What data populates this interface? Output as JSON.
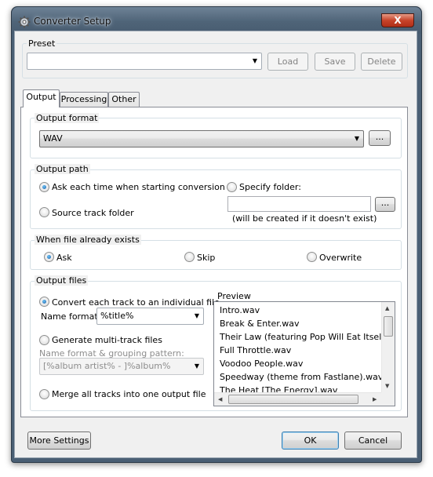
{
  "window": {
    "title": "Converter Setup",
    "close_glyph": "X"
  },
  "preset": {
    "group_label": "Preset",
    "value": "",
    "load_label": "Load",
    "save_label": "Save",
    "delete_label": "Delete"
  },
  "tabs": [
    {
      "label": "Output",
      "active": true
    },
    {
      "label": "Processing",
      "active": false
    },
    {
      "label": "Other",
      "active": false
    }
  ],
  "output_format": {
    "group_label": "Output format",
    "value": "WAV",
    "browse_label": "..."
  },
  "output_path": {
    "group_label": "Output path",
    "ask_each_time": "Ask each time when starting conversion",
    "source_track_folder": "Source track folder",
    "specify_folder": "Specify folder:",
    "folder_value": "",
    "browse_label": "...",
    "hint": "(will be created if it doesn't exist)",
    "selected": "ask_each_time"
  },
  "file_exists": {
    "group_label": "When file already exists",
    "ask": "Ask",
    "skip": "Skip",
    "overwrite": "Overwrite",
    "selected": "ask"
  },
  "output_files": {
    "group_label": "Output files",
    "individual": "Convert each track to an individual file",
    "name_format_label": "Name format:",
    "name_format_value": "%title%",
    "multi_track": "Generate multi-track files",
    "grouping_label": "Name format & grouping pattern:",
    "grouping_value": "[%album artist% - ]%album%",
    "merge": "Merge all tracks into one output file",
    "selected": "individual",
    "preview_label": "Preview",
    "preview_items": [
      "Intro.wav",
      "Break & Enter.wav",
      "Their Law (featuring Pop Will Eat Itself).wav",
      "Full Throttle.wav",
      "Voodoo People.wav",
      "Speedway (theme from Fastlane).wav",
      "The Heat [The Energy].wav"
    ]
  },
  "footer": {
    "more_settings_label": "More Settings",
    "ok_label": "OK",
    "cancel_label": "Cancel"
  },
  "colors": {
    "accent": "#3c7fb1",
    "titlebar": "#4f6478",
    "close_button": "#c7442a"
  }
}
